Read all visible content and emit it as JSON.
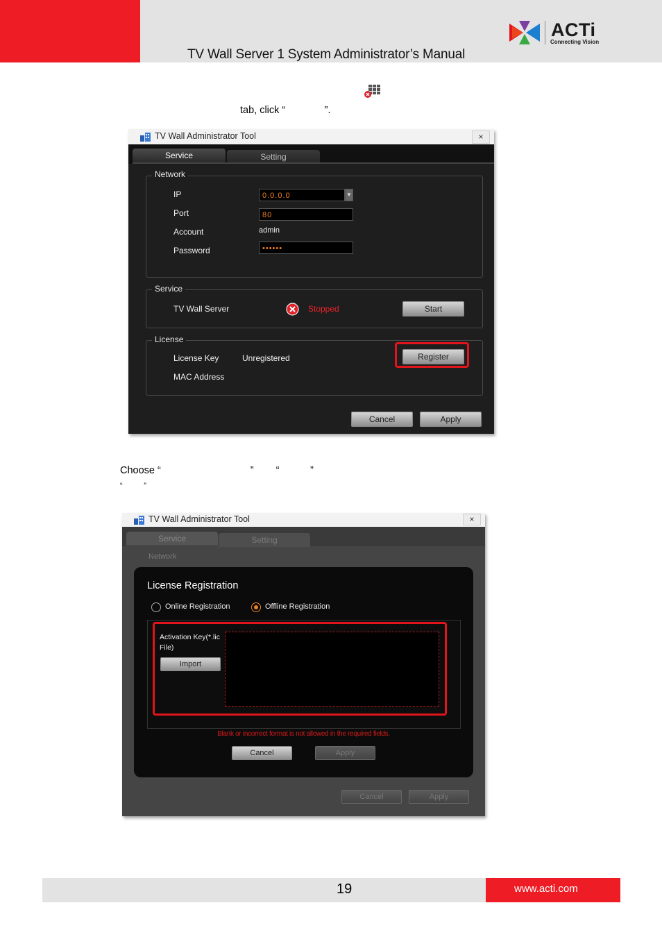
{
  "header": {
    "title": "TV Wall Server 1 System Administrator’s Manual",
    "logo_text": "ACTi",
    "logo_tagline": "Connecting Vision",
    "brand_red": "#ee1c25"
  },
  "body": {
    "line1": "tab, click “              ”.",
    "line2": "Choose “                                ”        “           ”",
    "line3": "“          ”"
  },
  "window1": {
    "title": "TV Wall Administrator Tool",
    "close": "×",
    "tabs": [
      "Service",
      "Setting"
    ],
    "network": {
      "label": "Network",
      "ip_label": "IP",
      "ip_value": "0.0.0.0",
      "port_label": "Port",
      "port_value": "80",
      "account_label": "Account",
      "account_value": "admin",
      "password_label": "Password",
      "password_value": "••••••"
    },
    "service": {
      "label": "Service",
      "server_label": "TV Wall Server",
      "status": "Stopped",
      "start_button": "Start"
    },
    "license": {
      "label": "License",
      "key_label": "License Key",
      "key_value": "Unregistered",
      "mac_label": "MAC Address",
      "register_button": "Register"
    },
    "cancel_button": "Cancel",
    "apply_button": "Apply"
  },
  "window2": {
    "title": "TV Wall Administrator Tool",
    "close": "×",
    "tabs": [
      "Service",
      "Setting"
    ],
    "network_label": "Network",
    "dialog": {
      "title": "License Registration",
      "option_online": "Online Registration",
      "option_offline": "Offline Registration",
      "activation_label": "Activation Key(*.lic File)",
      "import_button": "Import",
      "error": "Blank or incorrect format is not allowed in the required fields.",
      "cancel_button": "Cancel",
      "apply_button": "Apply"
    },
    "cancel_button": "Cancel",
    "apply_button": "Apply"
  },
  "footer": {
    "page_number": "19",
    "url": "www.acti.com"
  }
}
